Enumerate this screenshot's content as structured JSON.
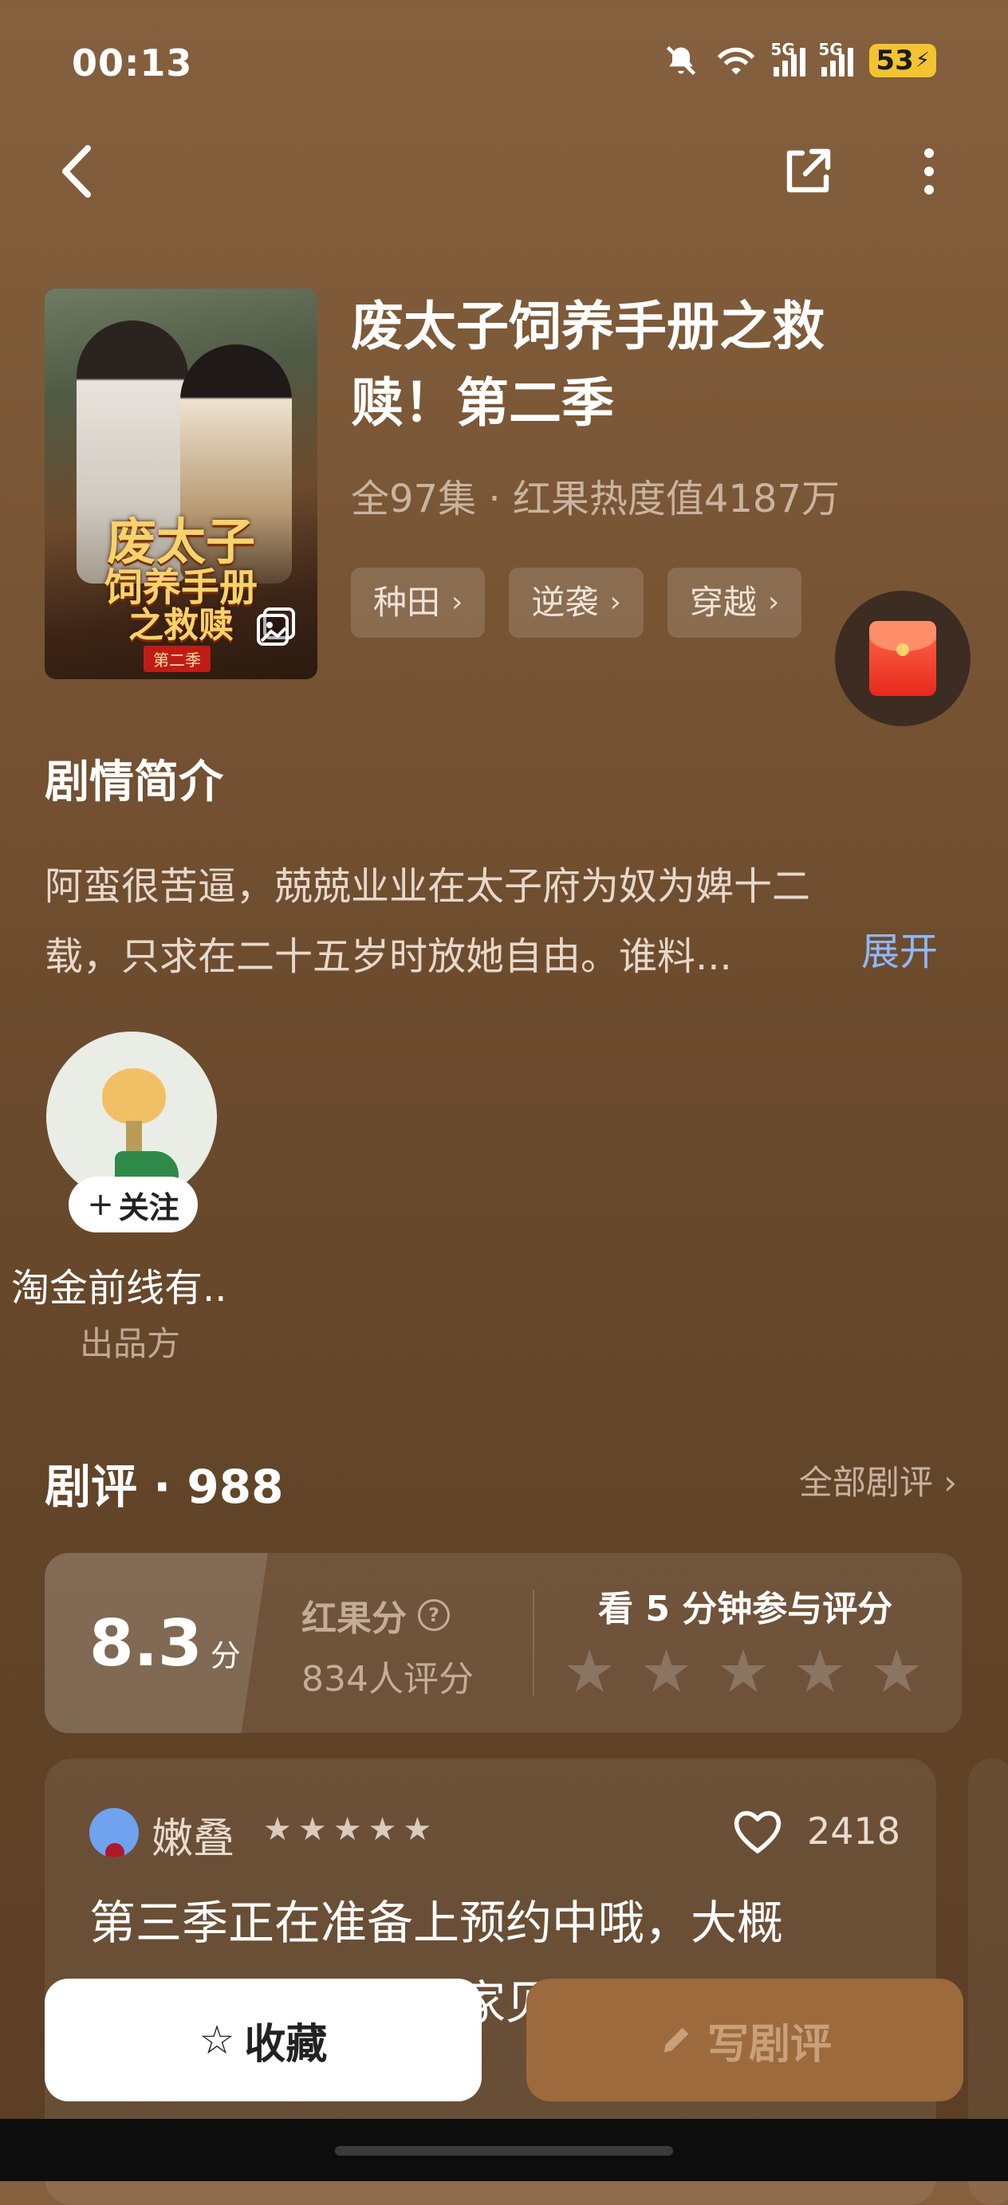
{
  "status_bar": {
    "time": "00:13",
    "net1": "5G",
    "net2": "5G",
    "battery": "53"
  },
  "nav": {
    "back_icon": "chevron-left-icon",
    "share_icon": "share-icon",
    "more_icon": "more-vertical-icon"
  },
  "poster": {
    "title_art_1": "废太子",
    "title_art_2": "饲养手册",
    "title_art_3": "之救赎",
    "badge": "第二季"
  },
  "drama": {
    "title": "废太子饲养手册之救赎！第二季",
    "meta": "全97集 · 红果热度值4187万",
    "tags": [
      {
        "label": "种田"
      },
      {
        "label": "逆袭"
      },
      {
        "label": "穿越"
      }
    ]
  },
  "synopsis": {
    "heading": "剧情简介",
    "line1": "阿蛮很苦逼，兢兢业业在太子府为奴为婢十二",
    "line2": "载，只求在二十五岁时放她自由。谁料...",
    "expand": "展开"
  },
  "producer": {
    "follow": "关注",
    "name": "淘金前线有..",
    "role": "出品方"
  },
  "reviews": {
    "heading": "剧评 · 988",
    "all_link": "全部剧评",
    "score": "8.3",
    "score_unit": "分",
    "score_label": "红果分",
    "score_count": "834人评分",
    "rate_prompt": "看 5 分钟参与评分",
    "rating_stars": 5
  },
  "review_item": {
    "user": "嫩叠",
    "stars": 5,
    "likes": "2418",
    "text_line1": "第三季正在准备上预约中哦，大概",
    "text_line2": "一周左右就会和大家见面啦，解解"
  },
  "bottom_bar": {
    "collect": "收藏",
    "write": "写剧评"
  },
  "colors": {
    "bg_top": "#85603e",
    "bg_bottom": "#5b3e24",
    "link": "#8fb8ff",
    "write_btn": "#9c6a3d",
    "battery": "#f3c430"
  }
}
